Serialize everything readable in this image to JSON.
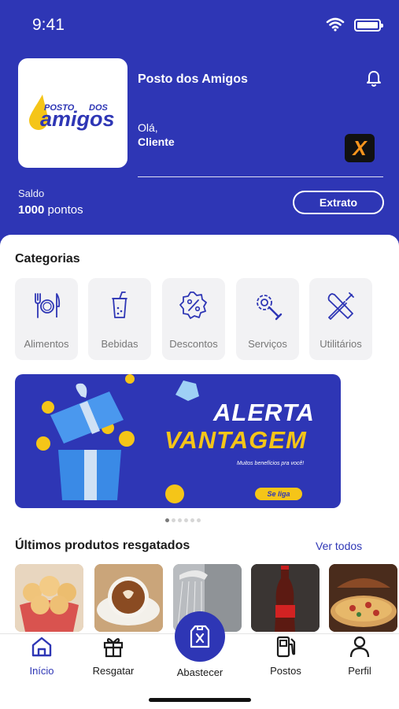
{
  "status_bar": {
    "time": "9:41"
  },
  "header": {
    "logo": {
      "line1": "POSTO",
      "line2": "DOS",
      "line3": "amigos"
    },
    "store_name": "Posto dos Amigos",
    "greeting": "Olá,",
    "client_name": "Cliente",
    "badge_letter": "X",
    "balance_label": "Saldo",
    "balance_value": "1000",
    "balance_unit": "pontos",
    "statement_button": "Extrato"
  },
  "categories": {
    "title": "Categorias",
    "items": [
      {
        "label": "Alimentos",
        "icon": "utensils-icon"
      },
      {
        "label": "Bebidas",
        "icon": "drink-icon"
      },
      {
        "label": "Descontos",
        "icon": "discount-icon"
      },
      {
        "label": "Serviços",
        "icon": "service-gear-icon"
      },
      {
        "label": "Utilitários",
        "icon": "tools-icon"
      }
    ]
  },
  "banner": {
    "title_line1": "ALERTA",
    "title_line2": "VANTAGEM",
    "subtitle": "Muitos benefícios pra você!",
    "cta": "Se liga",
    "carousel_count": 6,
    "carousel_active": 0
  },
  "recent_products": {
    "title": "Últimos produtos resgatados",
    "see_all": "Ver todos",
    "items": [
      "cheese-bread",
      "cappuccino",
      "shower",
      "cola-bottle",
      "pizza"
    ]
  },
  "tab_bar": {
    "items": [
      {
        "label": "Início",
        "icon": "home-icon",
        "active": true
      },
      {
        "label": "Resgatar",
        "icon": "gift-icon",
        "active": false
      },
      {
        "label": "Abastecer",
        "icon": "fuel-can-icon",
        "active": false
      },
      {
        "label": "Postos",
        "icon": "fuel-pump-icon",
        "active": false
      },
      {
        "label": "Perfil",
        "icon": "person-icon",
        "active": false
      }
    ]
  },
  "colors": {
    "brand_blue": "#2e36b5",
    "accent_yellow": "#f5c518"
  }
}
